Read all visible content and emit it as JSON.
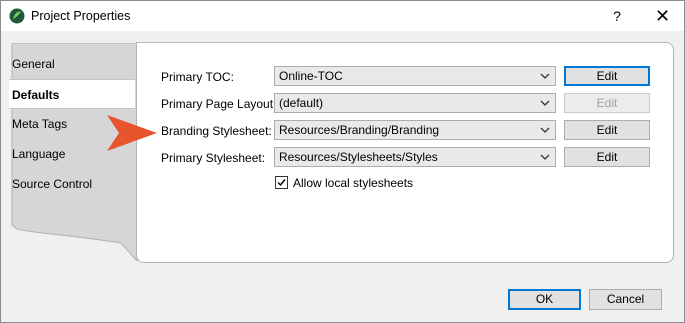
{
  "window": {
    "title": "Project Properties",
    "help_glyph": "?",
    "close_glyph": "✕"
  },
  "tabs": [
    {
      "label": "General"
    },
    {
      "label": "Defaults",
      "selected": true
    },
    {
      "label": "Meta Tags"
    },
    {
      "label": "Language"
    },
    {
      "label": "Source Control"
    }
  ],
  "rows": [
    {
      "label": "Primary TOC:",
      "value": "Online-TOC",
      "edit": "Edit",
      "edit_state": "focused"
    },
    {
      "label": "Primary Page Layout:",
      "value": "(default)",
      "edit": "Edit",
      "edit_state": "disabled"
    },
    {
      "label": "Branding Stylesheet:",
      "value": "Resources/Branding/Branding",
      "edit": "Edit",
      "edit_state": "normal"
    },
    {
      "label": "Primary Stylesheet:",
      "value": "Resources/Stylesheets/Styles",
      "edit": "Edit",
      "edit_state": "normal"
    }
  ],
  "allow_local": {
    "label": "Allow local stylesheets",
    "checked": true
  },
  "footer": {
    "ok": "OK",
    "cancel": "Cancel"
  },
  "colors": {
    "accent": "#0078d7",
    "callout_arrow": "#e8542e",
    "app_icon": "#2e8b57"
  }
}
